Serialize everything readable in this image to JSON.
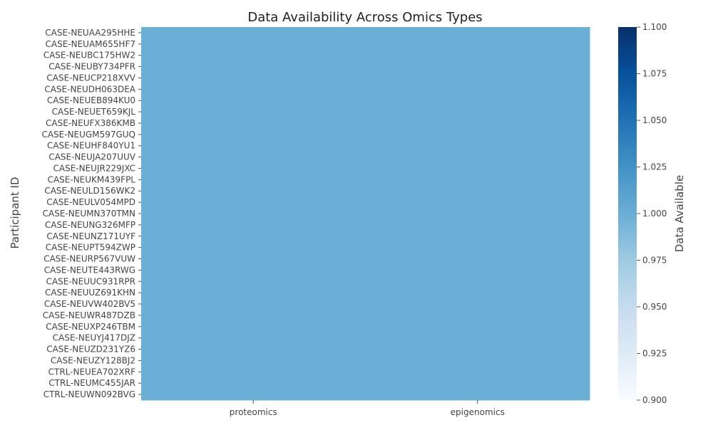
{
  "chart_data": {
    "type": "heatmap",
    "title": "Data Availability Across Omics Types",
    "ylabel": "Participant ID",
    "xlabel": "",
    "columns": [
      "proteomics",
      "epigenomics"
    ],
    "rows": [
      "CASE-NEUAA295HHE",
      "CASE-NEUAM655HF7",
      "CASE-NEUBC175HW2",
      "CASE-NEUBY734PFR",
      "CASE-NEUCP218XVV",
      "CASE-NEUDH063DEA",
      "CASE-NEUEB894KU0",
      "CASE-NEUET659KJL",
      "CASE-NEUFX386KMB",
      "CASE-NEUGM597GUQ",
      "CASE-NEUHF840YU1",
      "CASE-NEUJA207UUV",
      "CASE-NEUJR229JXC",
      "CASE-NEUKM439FPL",
      "CASE-NEULD156WK2",
      "CASE-NEULV054MPD",
      "CASE-NEUMN370TMN",
      "CASE-NEUNG326MFP",
      "CASE-NEUNZ171UYF",
      "CASE-NEUPT594ZWP",
      "CASE-NEURP567VUW",
      "CASE-NEUTE443RWG",
      "CASE-NEUUC931RPR",
      "CASE-NEUUZ691KHN",
      "CASE-NEUVW402BV5",
      "CASE-NEUWR487DZB",
      "CASE-NEUXP246TBM",
      "CASE-NEUYJ417DJZ",
      "CASE-NEUZD231YZ6",
      "CASE-NEUZY128BJ2",
      "CTRL-NEUEA702XRF",
      "CTRL-NEUMC455JAR",
      "CTRL-NEUWN092BVG"
    ],
    "values_fill": 1,
    "colorbar": {
      "label": "Data Available",
      "range": [
        0.9,
        1.1
      ],
      "ticks": [
        "0.900",
        "0.925",
        "0.950",
        "0.975",
        "1.000",
        "1.025",
        "1.050",
        "1.075",
        "1.100"
      ],
      "colormap": "Blues"
    }
  }
}
